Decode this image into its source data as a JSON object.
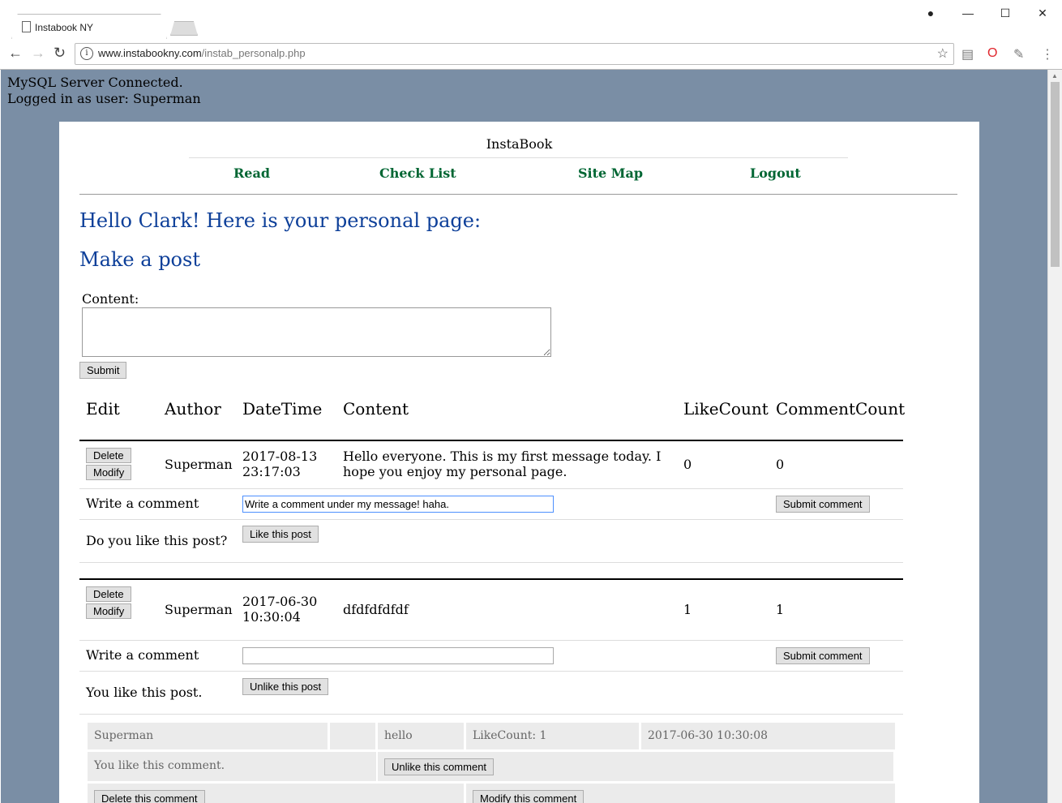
{
  "browser": {
    "tab_title": "Instabook NY",
    "url_domain": "www.instabookny.com",
    "url_path": "/instab_personalp.php"
  },
  "status": {
    "line1": "MySQL Server Connected.",
    "line2": "Logged in as user: Superman"
  },
  "site": {
    "brand": "InstaBook",
    "nav": [
      "Read",
      "Check List",
      "Site Map",
      "Logout"
    ]
  },
  "page": {
    "greeting": "Hello Clark! Here is your personal page:",
    "make_post_title": "Make a post",
    "content_label": "Content:",
    "submit_label": "Submit"
  },
  "table": {
    "headers": [
      "Edit",
      "Author",
      "DateTime",
      "Content",
      "LikeCount",
      "CommentCount"
    ],
    "delete_label": "Delete",
    "modify_label": "Modify",
    "write_comment_label": "Write a comment",
    "submit_comment_label": "Submit comment"
  },
  "posts": [
    {
      "author": "Superman",
      "date": "2017-08-13",
      "time": "23:17:03",
      "content": "Hello everyone. This is my first message today. I hope you enjoy my personal page.",
      "like_count": "0",
      "comment_count": "0",
      "comment_value": "Write a comment under my message! haha.",
      "like_prompt": "Do you like this post?",
      "like_button": "Like this post"
    },
    {
      "author": "Superman",
      "date": "2017-06-30",
      "time": "10:30:04",
      "content": "dfdfdfdfdf",
      "like_count": "1",
      "comment_count": "1",
      "comment_value": "",
      "like_prompt": "You like this post.",
      "like_button": "Unlike this post"
    }
  ],
  "comment": {
    "author": "Superman",
    "blank": "",
    "text": "hello",
    "likecount": "LikeCount: 1",
    "datetime": "2017-06-30 10:30:08",
    "like_status": "You like this comment.",
    "unlike_button": "Unlike this comment",
    "delete_button": "Delete this comment",
    "modify_button": "Modify this comment"
  }
}
